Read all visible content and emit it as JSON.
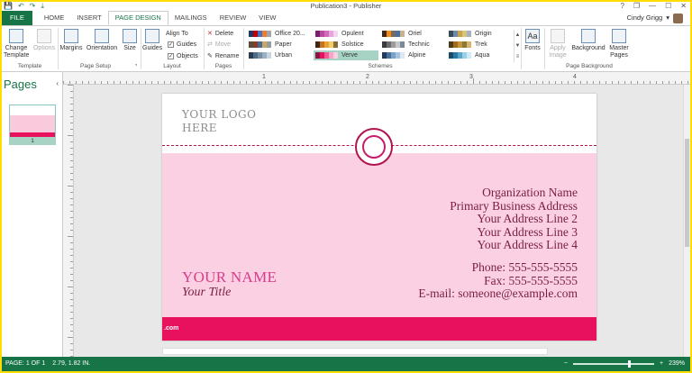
{
  "window": {
    "title": "Publication3 - Publisher",
    "help": "?",
    "restore": "❐",
    "minimize": "—",
    "maximize": "☐",
    "close": "✕"
  },
  "qat": [
    "💾",
    "↶",
    "↷",
    "⤓"
  ],
  "tabs": [
    "FILE",
    "HOME",
    "INSERT",
    "PAGE DESIGN",
    "MAILINGS",
    "REVIEW",
    "VIEW"
  ],
  "active_tab": "PAGE DESIGN",
  "user": {
    "name": "Cindy Grigg",
    "menu": "▾"
  },
  "ribbon": {
    "template": {
      "change_template": "Change Template",
      "options": "Options",
      "group": "Template"
    },
    "page_setup": {
      "margins": "Margins",
      "orientation": "Orientation",
      "size": "Size",
      "group": "Page Setup",
      "launcher": "⌝"
    },
    "layout": {
      "guides": "Guides",
      "align_to": "Align To",
      "guides_check": "Guides",
      "objects_check": "Objects",
      "group": "Layout"
    },
    "pages": {
      "delete": "Delete",
      "move": "Move",
      "rename": "Rename",
      "group": "Pages"
    },
    "schemes": {
      "group": "Schemes",
      "items": [
        {
          "name": "Office 20...",
          "colors": [
            "#1f3864",
            "#c00000",
            "#4472c4",
            "#ed7d31",
            "#a5a5a5"
          ]
        },
        {
          "name": "Paper",
          "colors": [
            "#5b4c3a",
            "#8a3b2f",
            "#4d6a8c",
            "#c8a86b",
            "#9a9a9a"
          ]
        },
        {
          "name": "Urban",
          "colors": [
            "#2d3b4e",
            "#4b6f8a",
            "#7a8fa3",
            "#9bb0c4",
            "#c9d6e2"
          ]
        },
        {
          "name": "Opulent",
          "colors": [
            "#7a1f6b",
            "#b84aa0",
            "#d36ac0",
            "#e6a6d8",
            "#f3d6ee"
          ]
        },
        {
          "name": "Solstice",
          "colors": [
            "#3b2a1a",
            "#c8731c",
            "#e3a33a",
            "#f2cd6a",
            "#8a6b3a"
          ]
        },
        {
          "name": "Verve",
          "colors": [
            "#8a1446",
            "#e8115e",
            "#f25894",
            "#f9a6c6",
            "#fbd0e2"
          ]
        },
        {
          "name": "Oriel",
          "colors": [
            "#3a2a1a",
            "#f28a1c",
            "#7a6a5a",
            "#4b6fa3",
            "#c9b38a"
          ]
        },
        {
          "name": "Technic",
          "colors": [
            "#3b3b3b",
            "#6b6b6b",
            "#9b9b9b",
            "#c8c8c8",
            "#7a8a9a"
          ]
        },
        {
          "name": "Alpine",
          "colors": [
            "#1f3b5a",
            "#4b6f9a",
            "#7aa3c8",
            "#a6c4e0",
            "#dce9f5"
          ]
        },
        {
          "name": "Origin",
          "colors": [
            "#3a4a5a",
            "#6b8aa3",
            "#c8a34b",
            "#d9c47a",
            "#a3b3c3"
          ]
        },
        {
          "name": "Trek",
          "colors": [
            "#4b3a1a",
            "#a36b1c",
            "#c8943a",
            "#8a7a3a",
            "#d9b36b"
          ]
        },
        {
          "name": "Aqua",
          "colors": [
            "#1a4b6b",
            "#2a7aa3",
            "#5aa6c8",
            "#9ad0e6",
            "#cfe9f5"
          ]
        }
      ],
      "selected": "Verve"
    },
    "fonts": {
      "label": "Fonts",
      "icon": "Aa"
    },
    "apply_image": {
      "label": "Apply Image"
    },
    "background": {
      "label": "Background"
    },
    "master_pages": {
      "label": "Master Pages"
    },
    "page_background_group": "Page Background"
  },
  "ruler": {
    "labels": [
      "1",
      "2",
      "3",
      "4"
    ]
  },
  "pages_pane": {
    "title": "Pages",
    "collapse": "‹",
    "page_number": "1"
  },
  "card": {
    "logo_line1": "YOUR LOGO",
    "logo_line2": "HERE",
    "org_lines": [
      "Organization Name",
      "Primary Business Address",
      "Your Address Line 2",
      "Your Address Line 3",
      "Your Address Line 4"
    ],
    "phone": "Phone: 555-555-5555",
    "fax": "Fax: 555-555-5555",
    "email": "E-mail: someone@example.com",
    "name": "YOUR NAME",
    "title": "Your Title",
    "watermark": ".com",
    "colors": {
      "accent": "#e8115e",
      "panel": "#fbd0e2",
      "text": "#7a1d45",
      "name": "#d93d8b"
    }
  },
  "status": {
    "page": "PAGE: 1 OF 1",
    "position": "2.79, 1.82 IN.",
    "zoom": "239%",
    "zoom_out": "−",
    "zoom_in": "+",
    "zoom_level": 0.69
  }
}
